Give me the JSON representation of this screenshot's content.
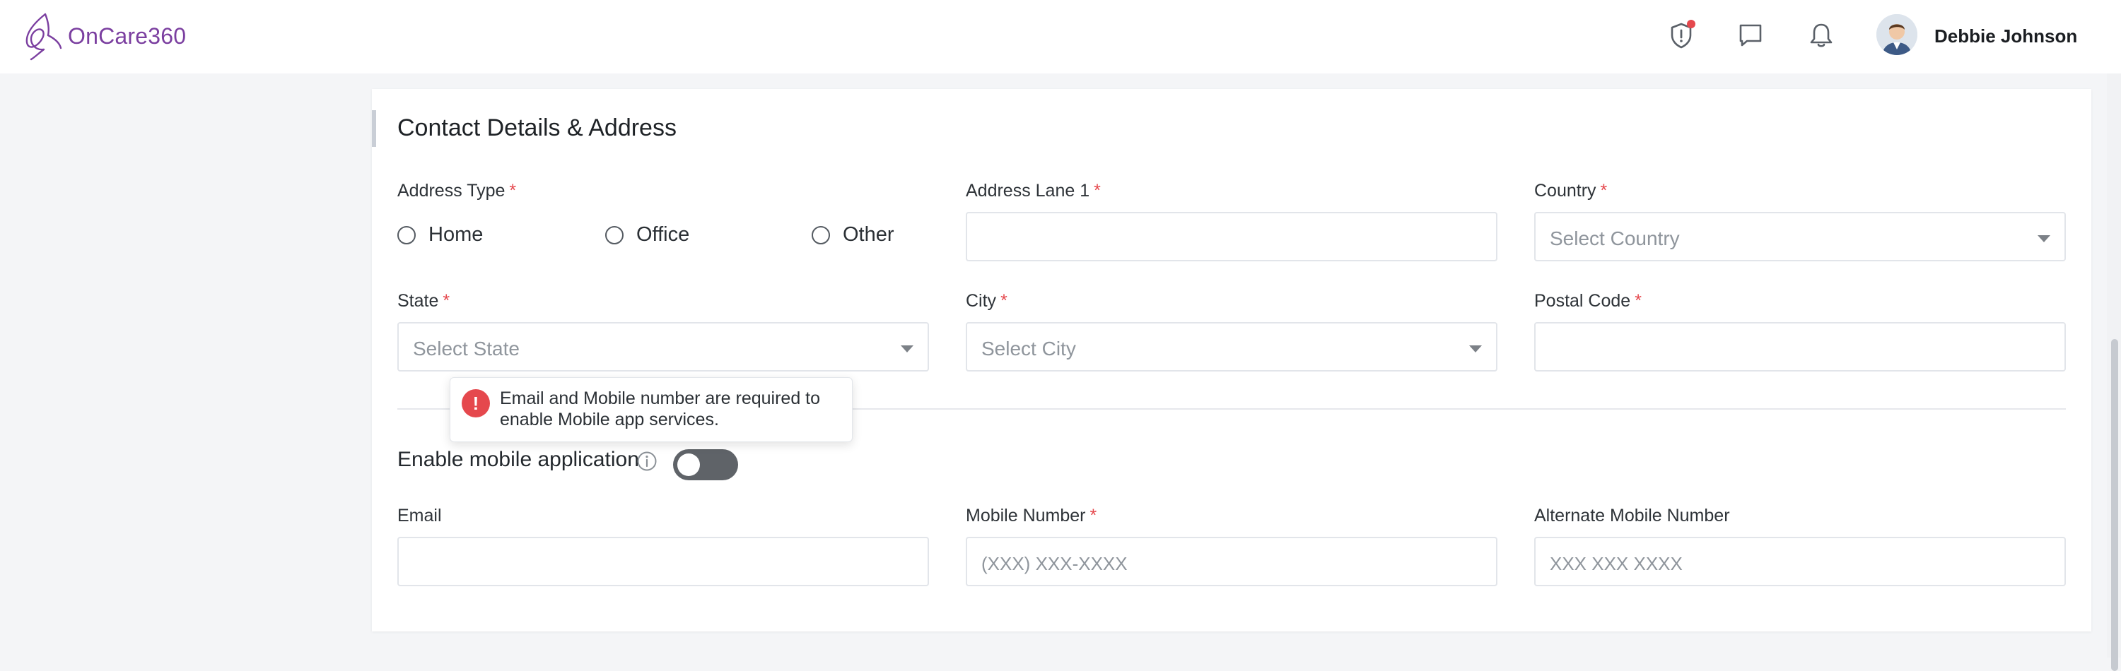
{
  "app": {
    "logo_text": "OnCare360"
  },
  "header": {
    "icons": [
      "shield-alert-icon",
      "chat-icon",
      "bell-icon"
    ],
    "notification_dot_color": "#e5484d",
    "user": {
      "name": "Debbie Johnson"
    }
  },
  "section": {
    "title": "Contact Details & Address"
  },
  "form": {
    "address_type": {
      "label": "Address Type",
      "required": "*",
      "options": [
        "Home",
        "Office",
        "Other"
      ]
    },
    "address_lane1": {
      "label": "Address Lane 1",
      "required": "*",
      "value": ""
    },
    "country": {
      "label": "Country",
      "required": "*",
      "placeholder": "Select Country"
    },
    "state": {
      "label": "State",
      "required": "*",
      "placeholder": "Select State"
    },
    "city": {
      "label": "City",
      "required": "*",
      "placeholder": "Select City"
    },
    "postal_code": {
      "label": "Postal Code",
      "required": "*",
      "value": ""
    },
    "mobile_app": {
      "label": "Enable mobile application",
      "enabled": false
    },
    "email": {
      "label": "Email",
      "value": ""
    },
    "mobile_number": {
      "label": "Mobile Number",
      "required": "*",
      "placeholder": "(XXX) XXX-XXXX"
    },
    "alt_mobile": {
      "label": "Alternate Mobile Number",
      "placeholder": "XXX XXX XXXX"
    }
  },
  "tooltip": {
    "icon": "!",
    "text": "Email and Mobile number are required to enable Mobile app services."
  },
  "colors": {
    "brand": "#7b3fa0",
    "required": "#e5484d",
    "toggle_off": "#5f6368"
  }
}
